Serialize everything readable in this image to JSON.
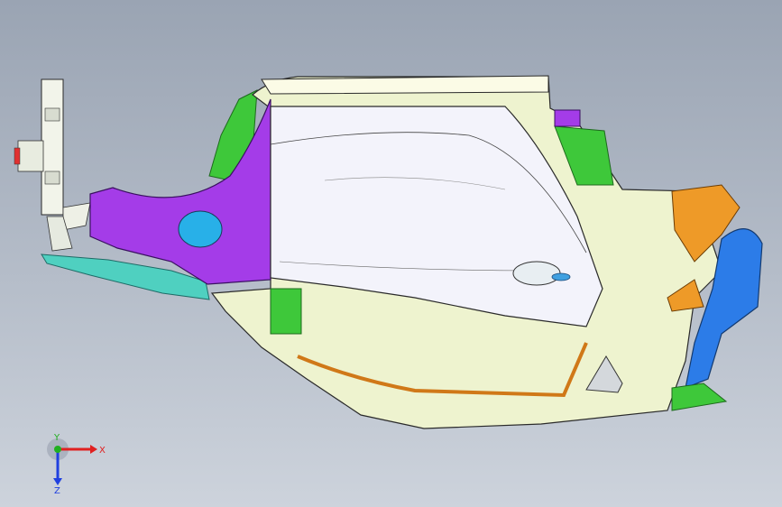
{
  "triad": {
    "x_label": "X",
    "y_label": "Y",
    "z_label": "Z",
    "x_color": "#e02020",
    "y_color": "#20b020",
    "z_color": "#2040e0"
  },
  "colors": {
    "background_top": "#9aa4b3",
    "background_bottom": "#cdd3dc",
    "door_skin": "#f3f3fb",
    "inner_panel": "#eef3cf",
    "wheel_arch": "#a43ce8",
    "lower_skirt": "#4fd0c0",
    "front_bracket": "#ee9a28",
    "front_block": "#2c7ce8",
    "green_part": "#3ec83a",
    "roof_rail": "#fbfbe6"
  }
}
